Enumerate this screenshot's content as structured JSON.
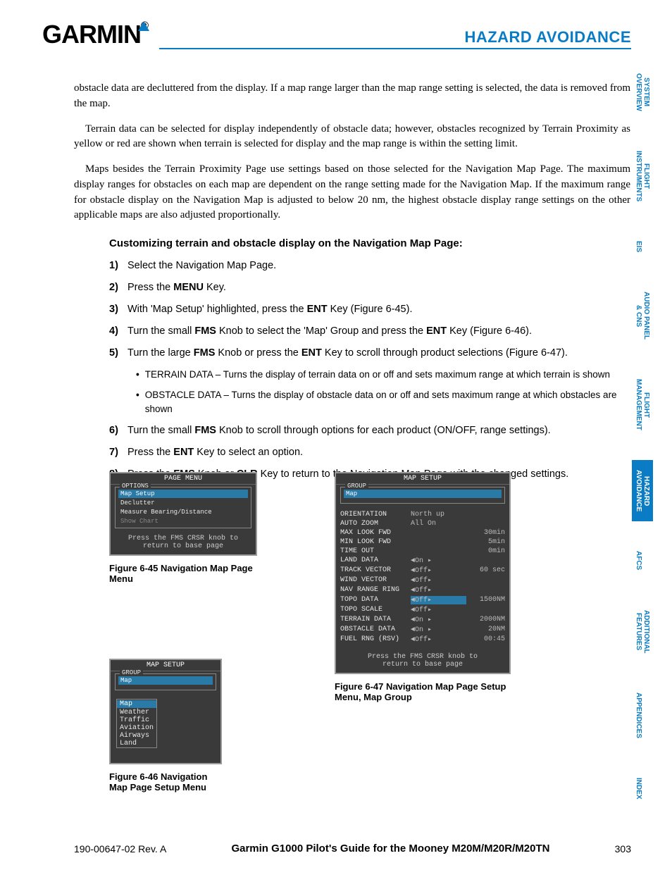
{
  "header": {
    "logo": "GARMIN",
    "title": "HAZARD AVOIDANCE"
  },
  "sidebar": [
    {
      "l1": "SYSTEM",
      "l2": "OVERVIEW",
      "active": false
    },
    {
      "l1": "FLIGHT",
      "l2": "INSTRUMENTS",
      "active": false
    },
    {
      "l1": "EIS",
      "l2": "",
      "active": false
    },
    {
      "l1": "AUDIO PANEL",
      "l2": "& CNS",
      "active": false
    },
    {
      "l1": "FLIGHT",
      "l2": "MANAGEMENT",
      "active": false
    },
    {
      "l1": "HAZARD",
      "l2": "AVOIDANCE",
      "active": true
    },
    {
      "l1": "AFCS",
      "l2": "",
      "active": false
    },
    {
      "l1": "ADDITIONAL",
      "l2": "FEATURES",
      "active": false
    },
    {
      "l1": "APPENDICES",
      "l2": "",
      "active": false
    },
    {
      "l1": "INDEX",
      "l2": "",
      "active": false
    }
  ],
  "body": {
    "p1": "obstacle data are decluttered from the display.  If a map range larger than the map range setting is selected, the data is removed from the map.",
    "p2": "Terrain data can be selected for display independently of obstacle data; however, obstacles recognized by Terrain Proximity as yellow or red are shown when terrain is selected for display and the map range is within the setting limit.",
    "p3": "Maps besides the Terrain Proximity Page use settings based on those selected for the Navigation Map Page. The maximum display ranges for obstacles on each map are dependent on the range setting made for the Navigation Map.  If the maximum range for obstacle display on the Navigation Map is adjusted to below 20 nm, the highest obstacle display range settings on the other applicable maps are also adjusted proportionally.",
    "subtitle": "Customizing terrain and obstacle display on the Navigation Map Page:"
  },
  "steps": {
    "s1": "Select the Navigation Map Page.",
    "s2a": "Press the ",
    "s2b": "MENU",
    "s2c": " Key.",
    "s3a": "With 'Map Setup' highlighted, press the ",
    "s3b": "ENT",
    "s3c": " Key (Figure 6-45).",
    "s4a": "Turn the small ",
    "s4b": "FMS",
    "s4c": " Knob to select the 'Map' Group and press the ",
    "s4d": "ENT",
    "s4e": " Key (Figure 6-46).",
    "s5a": "Turn the large ",
    "s5b": "FMS",
    "s5c": " Knob or press the ",
    "s5d": "ENT",
    "s5e": " Key to scroll through product selections (Figure 6-47).",
    "b1": "TERRAIN DATA – Turns the display of terrain data on or off and sets maximum range at which terrain is shown",
    "b2": "OBSTACLE DATA – Turns the display of obstacle data on or off and sets maximum range at which obstacles are shown",
    "s6a": "Turn the small ",
    "s6b": "FMS",
    "s6c": " Knob to scroll through options for each product (ON/OFF, range settings).",
    "s7a": "Press the ",
    "s7b": "ENT",
    "s7c": " Key to select an option.",
    "s8a": "Press the ",
    "s8b": "FMS",
    "s8c": " Knob or ",
    "s8d": "CLR",
    "s8e": " Key to return to the Navigation Map Page with the changed settings."
  },
  "fig645": {
    "title": "PAGE MENU",
    "group": "OPTIONS",
    "items": [
      "Map Setup",
      "Declutter",
      "Measure Bearing/Distance",
      "Show Chart"
    ],
    "foot1": "Press the FMS CRSR knob to",
    "foot2": "return to base page",
    "caption": "Figure 6-45  Navigation Map Page Menu"
  },
  "fig646": {
    "title": "MAP SETUP",
    "group": "GROUP",
    "sel": "Map",
    "dd": [
      "Map",
      "Weather",
      "Traffic",
      "Aviation",
      "Airways",
      "Land"
    ],
    "caption": "Figure 6-46  Navigation Map Page Setup Menu"
  },
  "fig647": {
    "title": "MAP SETUP",
    "group": "GROUP",
    "sel": "Map",
    "rows": [
      {
        "l": "ORIENTATION",
        "v": "North up",
        "v2": ""
      },
      {
        "l": "AUTO ZOOM",
        "v": "All On",
        "v2": ""
      },
      {
        "l": "  MAX LOOK FWD",
        "v": "",
        "v2": "30min"
      },
      {
        "l": "  MIN LOOK FWD",
        "v": "",
        "v2": "5min"
      },
      {
        "l": "  TIME OUT",
        "v": "",
        "v2": "0min"
      },
      {
        "l": "LAND DATA",
        "v": "◄On  ▸",
        "v2": ""
      },
      {
        "l": "TRACK VECTOR",
        "v": "◄Off▸",
        "v2": "60 sec"
      },
      {
        "l": "WIND VECTOR",
        "v": "◄Off▸",
        "v2": ""
      },
      {
        "l": "NAV RANGE RING",
        "v": "◄Off▸",
        "v2": ""
      },
      {
        "l": "TOPO DATA",
        "v": "◄Off▸",
        "v2": "1500NM",
        "hl": true
      },
      {
        "l": "TOPO SCALE",
        "v": "◄Off▸",
        "v2": ""
      },
      {
        "l": "TERRAIN DATA",
        "v": "◄On  ▸",
        "v2": "2000NM"
      },
      {
        "l": "OBSTACLE DATA",
        "v": "◄On  ▸",
        "v2": "20NM"
      },
      {
        "l": "FUEL RNG (RSV)",
        "v": "◄Off▸",
        "v2": "00:45"
      }
    ],
    "foot1": "Press the FMS CRSR knob to",
    "foot2": "return to base page",
    "caption": "Figure 6-47  Navigation Map Page Setup Menu, Map Group"
  },
  "footer": {
    "left": "190-00647-02  Rev. A",
    "center": "Garmin G1000 Pilot's Guide for the Mooney M20M/M20R/M20TN",
    "right": "303"
  }
}
